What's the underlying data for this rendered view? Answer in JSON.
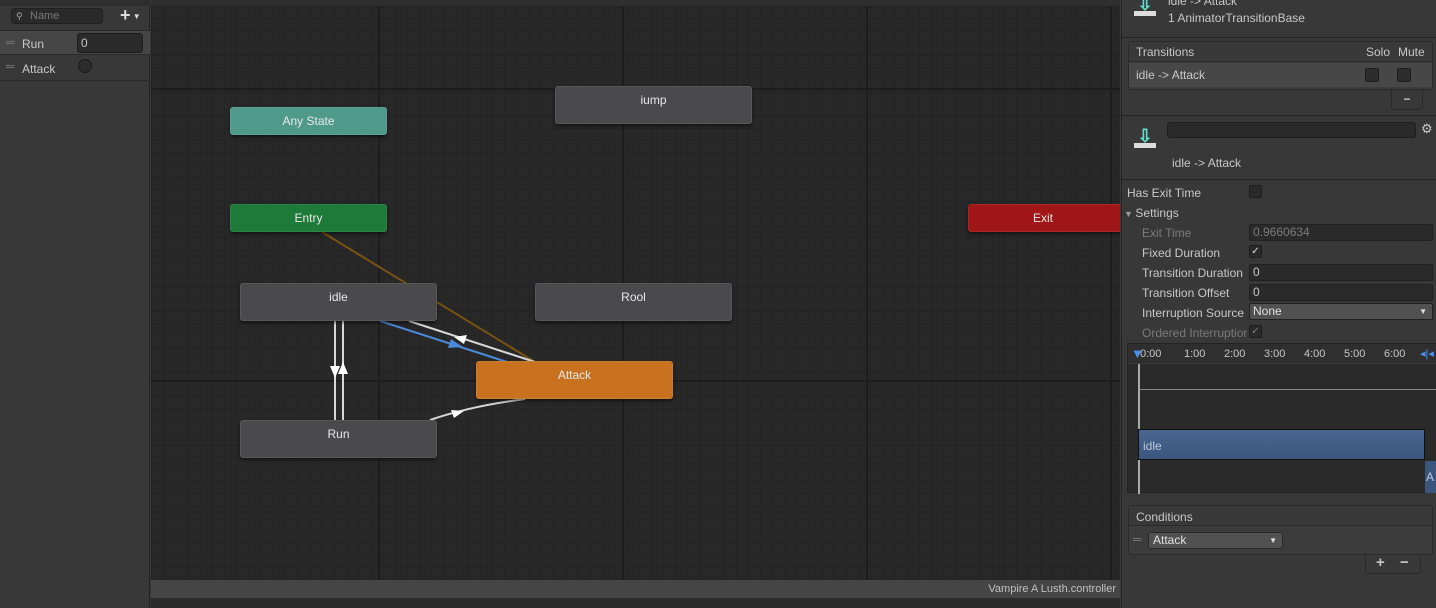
{
  "parameters": {
    "search_placeholder": "Name",
    "add_label": "+",
    "items": [
      {
        "name": "Run",
        "value": "0"
      },
      {
        "name": "Attack",
        "type": "trigger"
      }
    ]
  },
  "graph": {
    "nodes": {
      "any_state": "Any State",
      "jump": "iump",
      "entry": "Entry",
      "exit": "Exit",
      "idle": "idle",
      "rool": "Rool",
      "attack": "Attack",
      "run": "Run"
    },
    "footer": "Vampire A Lusth.controller"
  },
  "inspector": {
    "header_title": "idle -> Attack",
    "header_subtitle": "1 AnimatorTransitionBase",
    "transitions": {
      "title": "Transitions",
      "solo": "Solo",
      "mute": "Mute",
      "rows": [
        {
          "name": "idle -> Attack"
        }
      ],
      "remove_label": "−"
    },
    "transition_name": "idle -> Attack",
    "has_exit_time": {
      "label": "Has Exit Time",
      "checked": false
    },
    "settings_label": "Settings",
    "exit_time": {
      "label": "Exit Time",
      "value": "0.9660634"
    },
    "fixed_duration": {
      "label": "Fixed Duration",
      "checked": true
    },
    "transition_duration": {
      "label": "Transition Duration",
      "value": "0"
    },
    "transition_offset": {
      "label": "Transition Offset",
      "value": "0"
    },
    "interruption_source": {
      "label": "Interruption Source",
      "value": "None"
    },
    "ordered_interruption": {
      "label": "Ordered Interruption",
      "checked": true
    },
    "timeline": {
      "ticks": [
        "0:00",
        "1:00",
        "2:00",
        "3:00",
        "4:00",
        "5:00",
        "6:00"
      ],
      "source_clip": "idle",
      "dest_clip": "A"
    },
    "conditions": {
      "title": "Conditions",
      "items": [
        {
          "param": "Attack"
        }
      ],
      "add_label": "+",
      "remove_label": "−"
    }
  },
  "colors": {
    "any_state": "#4f9a8a",
    "entry": "#1e7a38",
    "exit": "#a01616",
    "attack": "#c87220",
    "transition_blue": "#4a8ad8"
  }
}
